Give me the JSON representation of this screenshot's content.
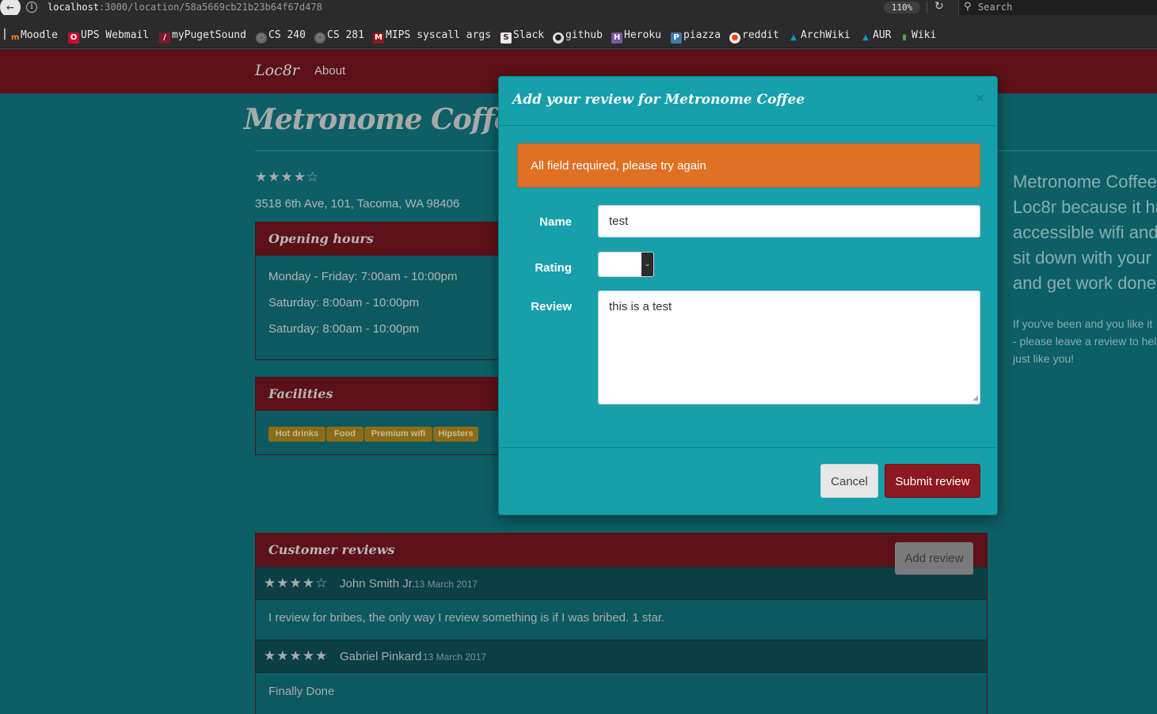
{
  "browser": {
    "url_host": "localhost",
    "url_path": ":3000/location/58a5669cb21b23b64f67d478",
    "zoom": "110%",
    "search_placeholder": "Search",
    "bookmarks": [
      "Moodle",
      "UPS Webmail",
      "myPugetSound",
      "CS 240",
      "CS 281",
      "MIPS syscall args",
      "Slack",
      "github",
      "Heroku",
      "piazza",
      "reddit",
      "ArchWiki",
      "AUR",
      "Wiki"
    ]
  },
  "nav": {
    "brand": "Loc8r",
    "about": "About"
  },
  "page": {
    "title": "Metronome Coffee",
    "rating_stars": "★★★★☆",
    "address": "3518 6th Ave, 101, Tacoma, WA 98406"
  },
  "hours": {
    "heading": "Opening hours",
    "lines": [
      "Monday - Friday: 7:00am - 10:00pm",
      "Saturday: 8:00am - 10:00pm",
      "Saturday: 8:00am - 10:00pm"
    ]
  },
  "facilities": {
    "heading": "Facilities",
    "tags": [
      "Hot drinks",
      "Food",
      "Premium wifi",
      "Hipsters"
    ]
  },
  "sidebar": {
    "lines": [
      "Metronome Coffee",
      "Loc8r because it ha",
      "accessible wifi and",
      "sit down with your",
      "and get work done"
    ],
    "small": [
      "If you've been and you like it",
      "- please leave a review to hel",
      "just like you!"
    ]
  },
  "reviews": {
    "heading": "Customer reviews",
    "add_label": "Add review",
    "items": [
      {
        "stars": "★★★★☆",
        "author": "John Smith Jr.",
        "date": "13 March 2017",
        "text": "I review for bribes, the only way I review something is if I was bribed. 1 star."
      },
      {
        "stars": "★★★★★",
        "author": "Gabriel Pinkard",
        "date": "13 March 2017",
        "text": "Finally Done"
      }
    ]
  },
  "modal": {
    "title": "Add your review for Metronome Coffee",
    "close": "×",
    "alert": "All field required, please try again",
    "name_label": "Name",
    "name_value": "test",
    "rating_label": "Rating",
    "review_label": "Review",
    "review_value": "this is a test",
    "cancel_label": "Cancel",
    "submit_label": "Submit review"
  },
  "colors": {
    "page_bg": "#0c5f65",
    "nav_bg": "#5b1117",
    "modal_bg": "#15a0ab",
    "alert_bg": "#e07023",
    "submit_bg": "#8c1822",
    "tag_bg": "#8c6d16"
  }
}
